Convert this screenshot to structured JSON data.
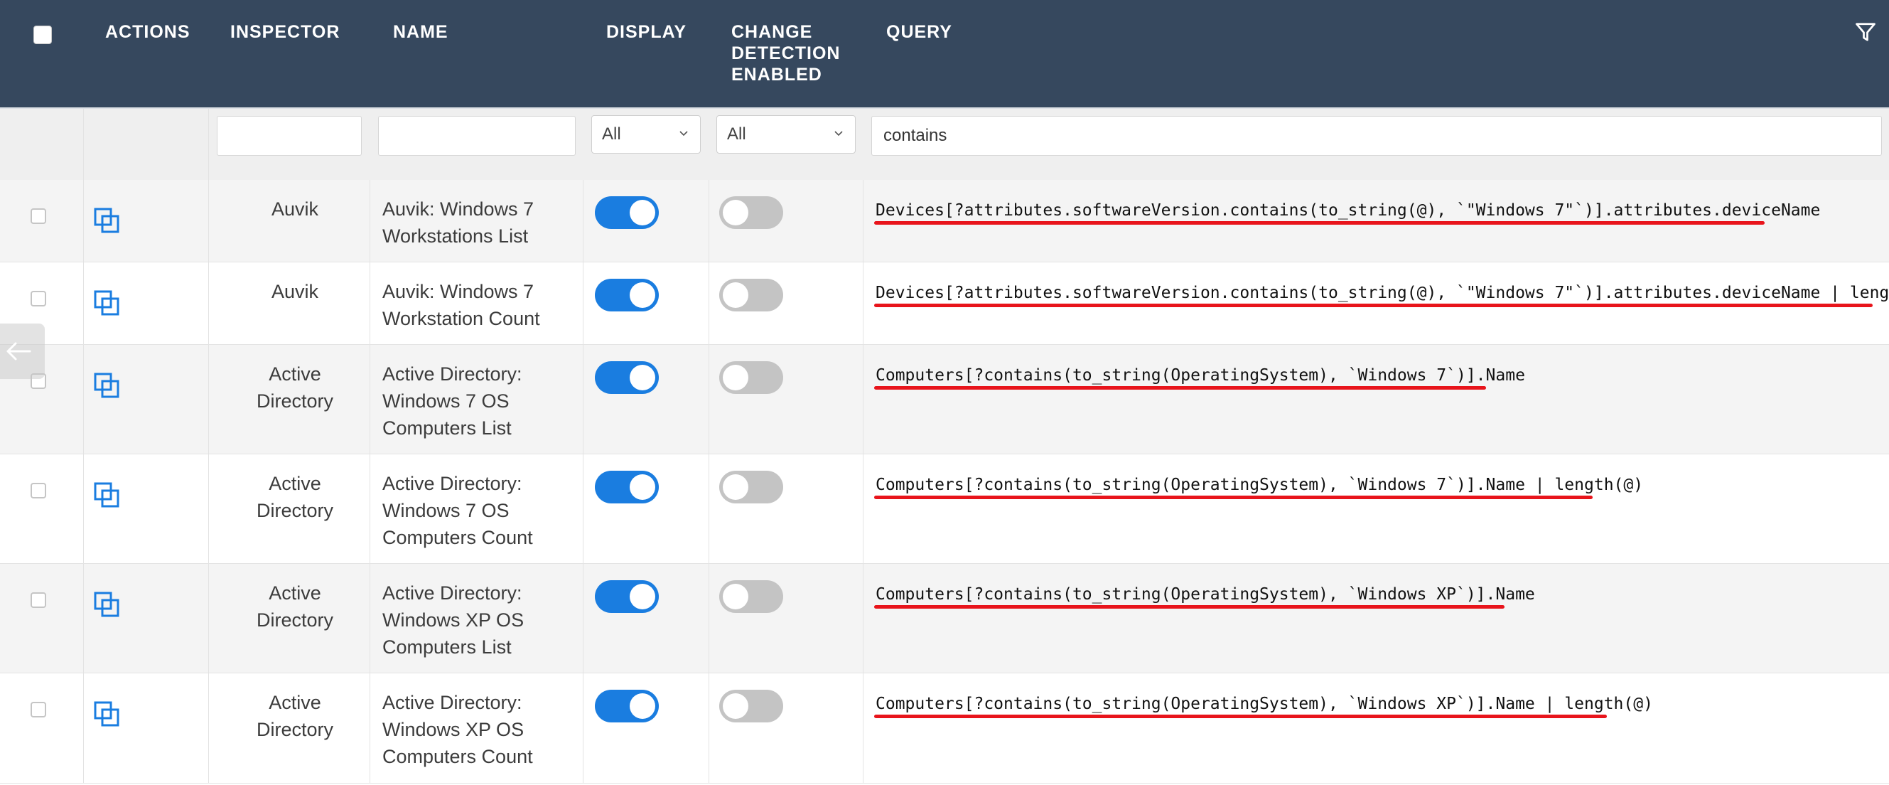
{
  "header": {
    "actions": "ACTIONS",
    "inspector": "INSPECTOR",
    "name": "NAME",
    "display": "DISPLAY",
    "change_detection": [
      "CHANGE",
      "DETECTION",
      "ENABLED"
    ],
    "query": "QUERY",
    "filter_icon": "filter-icon",
    "select_all_checked": false
  },
  "filters": {
    "inspector_value": "",
    "name_value": "",
    "display_selected": "All",
    "change_detection_selected": "All",
    "query_value": "contains"
  },
  "rows": [
    {
      "inspector": [
        "Auvik"
      ],
      "name": [
        "Auvik: Windows 7",
        "Workstations List"
      ],
      "display_enabled": true,
      "change_detection_enabled": false,
      "query": "Devices[?attributes.softwareVersion.contains(to_string(@), `\"Windows 7\"`)].attributes.deviceName"
    },
    {
      "inspector": [
        "Auvik"
      ],
      "name": [
        "Auvik: Windows 7",
        "Workstation Count"
      ],
      "display_enabled": true,
      "change_detection_enabled": false,
      "query": "Devices[?attributes.softwareVersion.contains(to_string(@), `\"Windows 7\"`)].attributes.deviceName | length(@)"
    },
    {
      "inspector": [
        "Active",
        "Directory"
      ],
      "name": [
        "Active Directory:",
        "Windows 7 OS",
        "Computers List"
      ],
      "display_enabled": true,
      "change_detection_enabled": false,
      "query": "Computers[?contains(to_string(OperatingSystem), `Windows 7`)].Name"
    },
    {
      "inspector": [
        "Active",
        "Directory"
      ],
      "name": [
        "Active Directory:",
        "Windows 7 OS",
        "Computers Count"
      ],
      "display_enabled": true,
      "change_detection_enabled": false,
      "query": "Computers[?contains(to_string(OperatingSystem), `Windows 7`)].Name | length(@)"
    },
    {
      "inspector": [
        "Active",
        "Directory"
      ],
      "name": [
        "Active Directory:",
        "Windows XP OS",
        "Computers List"
      ],
      "display_enabled": true,
      "change_detection_enabled": false,
      "query": "Computers[?contains(to_string(OperatingSystem), `Windows XP`)].Name"
    },
    {
      "inspector": [
        "Active",
        "Directory"
      ],
      "name": [
        "Active Directory:",
        "Windows XP OS",
        "Computers Count"
      ],
      "display_enabled": true,
      "change_detection_enabled": false,
      "query": "Computers[?contains(to_string(OperatingSystem), `Windows XP`)].Name | length(@)"
    }
  ],
  "colors": {
    "header_bg": "#36485e",
    "toggle_on": "#1a7de0",
    "toggle_off": "#c4c4c4",
    "highlight_underline": "#e8141b"
  }
}
